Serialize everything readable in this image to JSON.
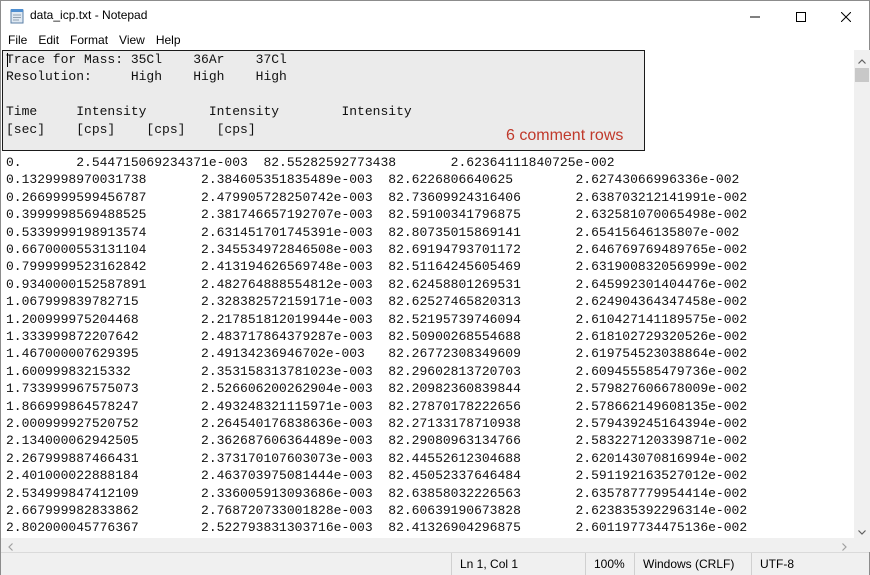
{
  "window": {
    "title": "data_icp.txt - Notepad"
  },
  "menu": [
    "File",
    "Edit",
    "Format",
    "View",
    "Help"
  ],
  "header_lines": [
    "Trace for Mass: 35Cl    36Ar    37Cl",
    "Resolution:     High    High    High",
    "",
    "Time     Intensity        Intensity        Intensity",
    "[sec]    [cps]    [cps]    [cps]"
  ],
  "annotation": {
    "label": "6 comment rows",
    "color": "#c0392b"
  },
  "data_lines": [
    "0.       2.544715069234371e-003  82.55282592773438       2.62364111840725e-002",
    "0.1329998970031738       2.384605351835489e-003  82.6226806640625        2.62743066996336e-002",
    "0.2669999599456787       2.479905728250742e-003  82.73609924316406       2.638703212141991e-002",
    "0.3999998569488525       2.381746657192707e-003  82.59100341796875       2.632581070065498e-002",
    "0.5339999198913574       2.631451701745391e-003  82.80735015869141       2.65415646135807e-002",
    "0.6670000553131104       2.345534972846508e-003  82.69194793701172       2.646769769489765e-002",
    "0.7999999523162842       2.413194626569748e-003  82.51164245605469       2.631900832056999e-002",
    "0.9340000152587891       2.482764888554812e-003  82.62458801269531       2.645992301404476e-002",
    "1.067999839782715        2.328382572159171e-003  82.62527465820313       2.624904364347458e-002",
    "1.200999975204468        2.217851812019944e-003  82.52195739746094       2.610427141189575e-002",
    "1.333999872207642        2.483717864379287e-003  82.50900268554688       2.618102729320526e-002",
    "1.467000007629395        2.49134236946702e-003   82.26772308349609       2.619754523038864e-002",
    "1.60099983215332         2.353158313781023e-003  82.29602813720703       2.609455585479736e-002",
    "1.733999967575073        2.526606200262904e-003  82.20982360839844       2.579827606678009e-002",
    "1.866999864578247        2.493248321115971e-003  82.27870178222656       2.578662149608135e-002",
    "2.000999927520752        2.264540176838636e-003  82.27133178710938       2.579439245164394e-002",
    "2.134000062942505        2.362687606364489e-003  82.29080963134766       2.583227120339871e-002",
    "2.267999887466431        2.373170107603073e-003  82.44552612304688       2.620143070816994e-002",
    "2.401000022888184        2.463703975081444e-003  82.45052337646484       2.591192163527012e-002",
    "2.534999847412109        2.336005913093686e-003  82.63858032226563       2.635787779954414e-002",
    "2.667999982833862        2.768720733001828e-003  82.60639190673828       2.623835392296314e-002",
    "2.802000045776367        2.522793831303716e-003  82.41326904296875       2.601197734475136e-002"
  ],
  "status": {
    "position": "Ln 1, Col 1",
    "zoom": "100%",
    "line_ending": "Windows (CRLF)",
    "encoding": "UTF-8"
  }
}
